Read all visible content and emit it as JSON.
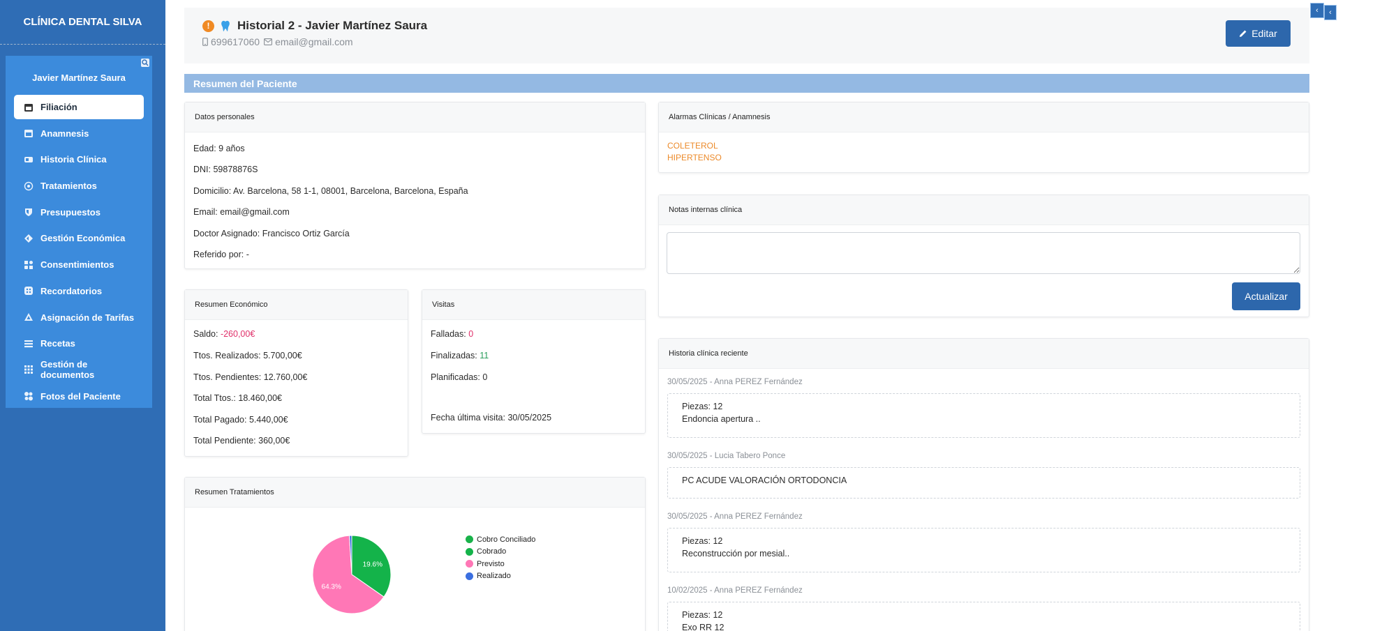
{
  "brand": "CLÍNICA DENTAL SILVA",
  "sidebar": {
    "patient_name": "Javier Martínez Saura",
    "items": [
      {
        "label": "Filiación",
        "icon": "calendar-icon",
        "active": true
      },
      {
        "label": "Anamnesis",
        "icon": "calendar-icon"
      },
      {
        "label": "Historia Clínica",
        "icon": "id-card-icon"
      },
      {
        "label": "Tratamientos",
        "icon": "target-icon"
      },
      {
        "label": "Presupuestos",
        "icon": "shield-icon"
      },
      {
        "label": "Gestión Económica",
        "icon": "diamond-icon"
      },
      {
        "label": "Consentimientos",
        "icon": "grid-icon"
      },
      {
        "label": "Recordatorios",
        "icon": "dice-icon"
      },
      {
        "label": "Asignación de Tarifas",
        "icon": "triangle-icon"
      },
      {
        "label": "Recetas",
        "icon": "list-icon"
      },
      {
        "label": "Gestión de documentos",
        "icon": "dots-grid-icon"
      },
      {
        "label": "Fotos del Paciente",
        "icon": "circles-icon"
      }
    ]
  },
  "header": {
    "alert": "!",
    "title": "Historial 2 - Javier Martínez Saura",
    "phone": "699617060",
    "email": "email@gmail.com",
    "edit_label": "Editar"
  },
  "summary_title": "Resumen del Paciente",
  "personal": {
    "title": "Datos personales",
    "edad_label": "Edad:",
    "edad": "9 años",
    "dni_label": "DNI:",
    "dni": "59878876S",
    "domicilio_label": "Domicilio:",
    "domicilio": "Av. Barcelona, 58 1-1, 08001, Barcelona, Barcelona, España",
    "email_label": "Email:",
    "email": "email@gmail.com",
    "doctor_label": "Doctor Asignado:",
    "doctor": "Francisco Ortiz García",
    "referido_label": "Referido por:",
    "referido": "-"
  },
  "alarms": {
    "title": "Alarmas Clínicas / Anamnesis",
    "items": [
      "COLETEROL",
      "HIPERTENSO"
    ]
  },
  "notes": {
    "title": "Notas internas clínica",
    "value": "",
    "update_label": "Actualizar"
  },
  "economic": {
    "title": "Resumen Económico",
    "saldo_label": "Saldo:",
    "saldo": "-260,00€",
    "realizados_label": "Ttos. Realizados:",
    "realizados": "5.700,00€",
    "pendientes_label": "Ttos. Pendientes:",
    "pendientes": "12.760,00€",
    "total_label": "Total Ttos.:",
    "total": "18.460,00€",
    "pagado_label": "Total Pagado:",
    "pagado": "5.440,00€",
    "total_pend_label": "Total Pendiente:",
    "total_pend": "360,00€"
  },
  "visits": {
    "title": "Visitas",
    "falladas_label": "Falladas:",
    "falladas": "0",
    "finalizadas_label": "Finalizadas:",
    "finalizadas": "11",
    "planificadas_label": "Planificadas:",
    "planificadas": "0",
    "ultima_label": "Fecha última visita:",
    "ultima": "30/05/2025"
  },
  "history": {
    "title": "Historia clínica reciente",
    "entries": [
      {
        "date": "30/05/2025 - Anna PEREZ Fernández",
        "lines": [
          "Piezas: 12",
          "Endoncia apertura .."
        ]
      },
      {
        "date": "30/05/2025 - Lucia Tabero Ponce",
        "lines": [
          "PC ACUDE VALORACIÓN ORTODONCIA"
        ]
      },
      {
        "date": "30/05/2025 - Anna PEREZ Fernández",
        "lines": [
          "Piezas: 12",
          "Reconstrucción por mesial.."
        ]
      },
      {
        "date": "10/02/2025 - Anna PEREZ Fernández",
        "lines": [
          "Piezas: 12",
          "Exo RR 12"
        ]
      }
    ]
  },
  "treatments": {
    "title": "Resumen Tratamientos"
  },
  "chart_data": {
    "type": "pie",
    "title": "",
    "categories": [
      "Cobro Conciliado",
      "Cobrado",
      "Previsto",
      "Realizado"
    ],
    "values": [
      0,
      34.7,
      64.3,
      1.0
    ],
    "value_labels": [
      "",
      "19.6%",
      "64.3%",
      ""
    ],
    "colors": [
      "#19b24a",
      "#14b34a",
      "#ff77b6",
      "#3b6fe0"
    ],
    "legend": "right"
  },
  "colors": {
    "primary": "#2f6db5",
    "accent": "#3c8bdc",
    "button": "#2d67ac",
    "alarm": "#ec8a2a",
    "negative": "#e0306a"
  }
}
